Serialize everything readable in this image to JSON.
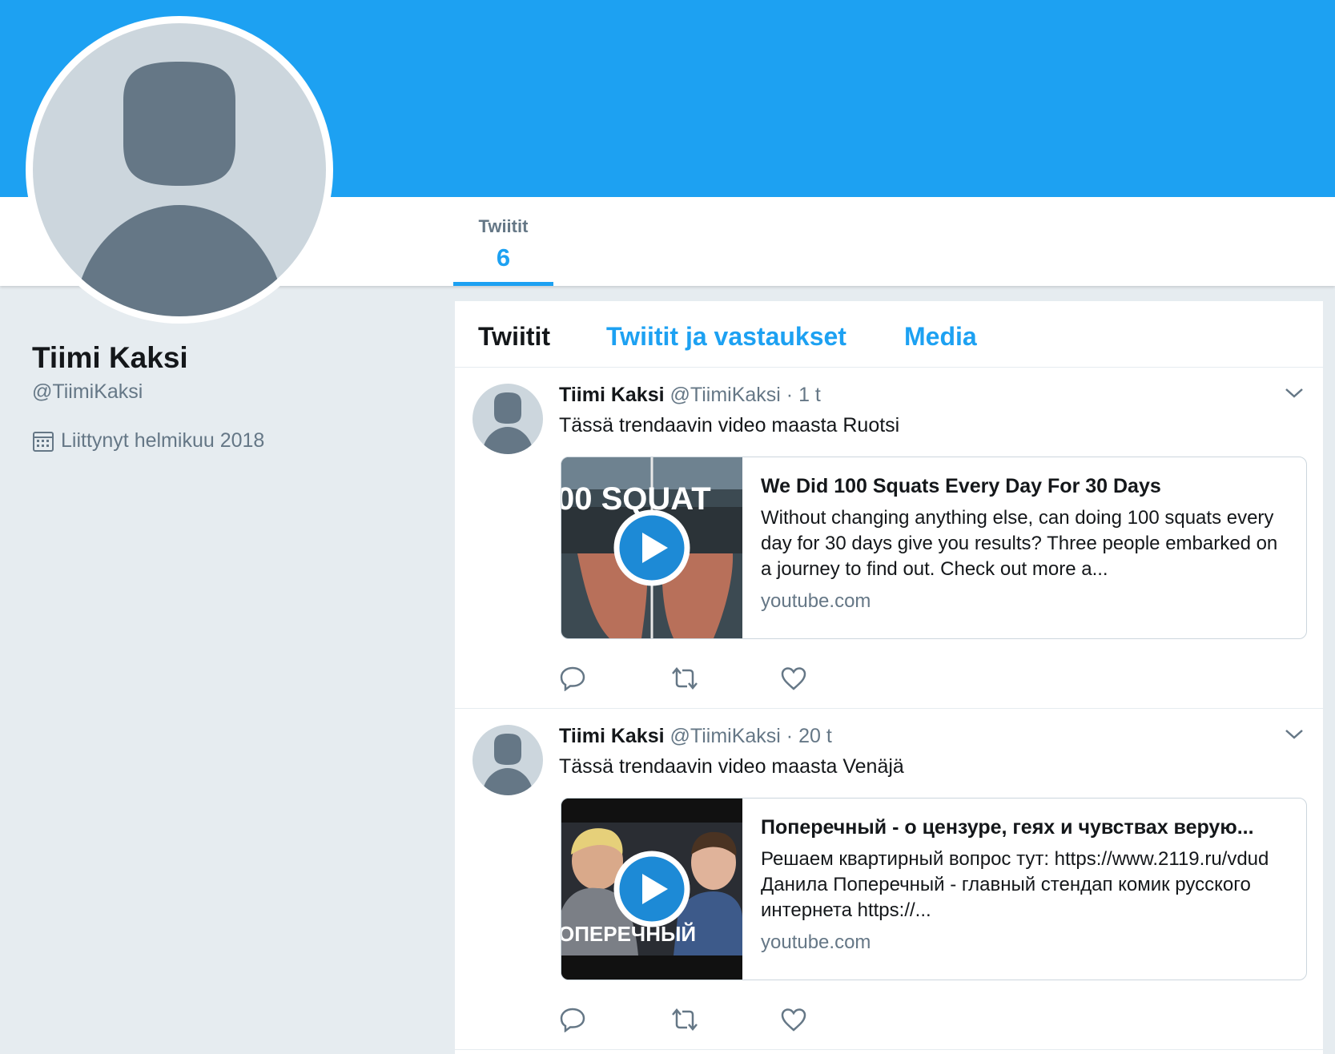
{
  "colors": {
    "accent": "#1da1f2",
    "background": "#e6ecf0",
    "text": "#14171a",
    "muted": "#657786"
  },
  "nav": {
    "stat_label": "Twiitit",
    "stat_value": "6"
  },
  "profile": {
    "name": "Tiimi Kaksi",
    "handle": "@TiimiKaksi",
    "joined": "Liittynyt helmikuu 2018",
    "avatar_icon": "default-avatar-icon",
    "joined_icon": "calendar-icon"
  },
  "timeline": {
    "tabs": [
      {
        "label": "Twiitit",
        "active": true
      },
      {
        "label": "Twiitit ja vastaukset",
        "active": false
      },
      {
        "label": "Media",
        "active": false
      }
    ],
    "tweets": [
      {
        "name": "Tiimi Kaksi",
        "handle": "@TiimiKaksi",
        "time": "· 1 t",
        "text": "Tässä trendaavin video maasta Ruotsi",
        "card": {
          "title": "We Did 100 Squats Every Day For 30 Days",
          "description": "Without changing anything else, can doing 100 squats every day for 30 days give you results? Three people embarked on a journey to find out. Check out more a...",
          "domain": "youtube.com",
          "thumb_text": "00 SQUAT"
        }
      },
      {
        "name": "Tiimi Kaksi",
        "handle": "@TiimiKaksi",
        "time": "· 20 t",
        "text": "Tässä trendaavin video maasta Venäjä",
        "card": {
          "title": "Поперечный - о цензуре, геях и чувствах верую...",
          "description": "Решаем квартирный вопрос тут: https://www.2119.ru/vdud Данила Поперечный - главный стендап комик русского интернета https://...",
          "domain": "youtube.com",
          "thumb_text": "ОПЕРЕЧНЫЙ"
        }
      }
    ]
  }
}
